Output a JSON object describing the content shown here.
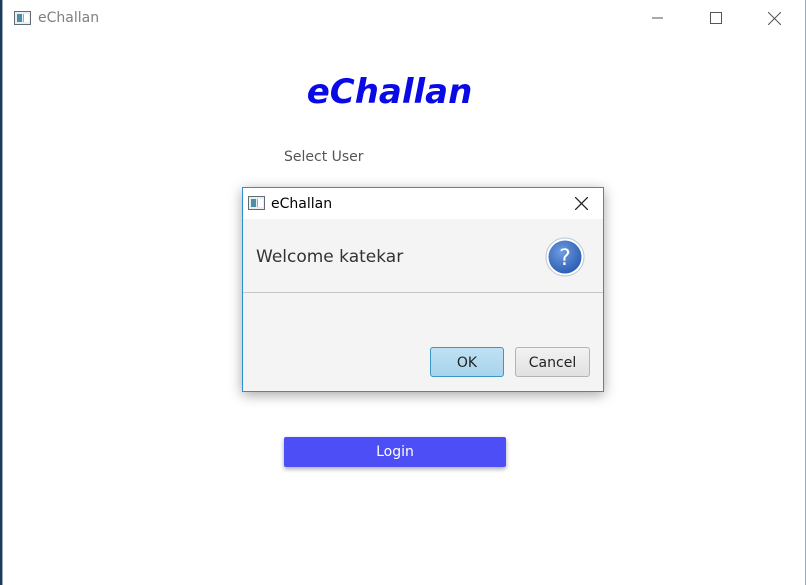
{
  "window": {
    "title": "eChallan",
    "minimize_icon": "minimize-icon",
    "maximize_icon": "maximize-icon",
    "close_icon": "close-icon"
  },
  "main": {
    "heading": "eChallan",
    "select_user_label": "Select User",
    "login_label": "Login"
  },
  "dialog": {
    "title": "eChallan",
    "message": "Welcome katekar",
    "icon": "question-icon",
    "ok_label": "OK",
    "cancel_label": "Cancel"
  },
  "colors": {
    "heading": "#0a0ae6",
    "login_button": "#4e4ef7",
    "dialog_border": "#2e8fd1",
    "question_icon": "#3a6fc4"
  }
}
